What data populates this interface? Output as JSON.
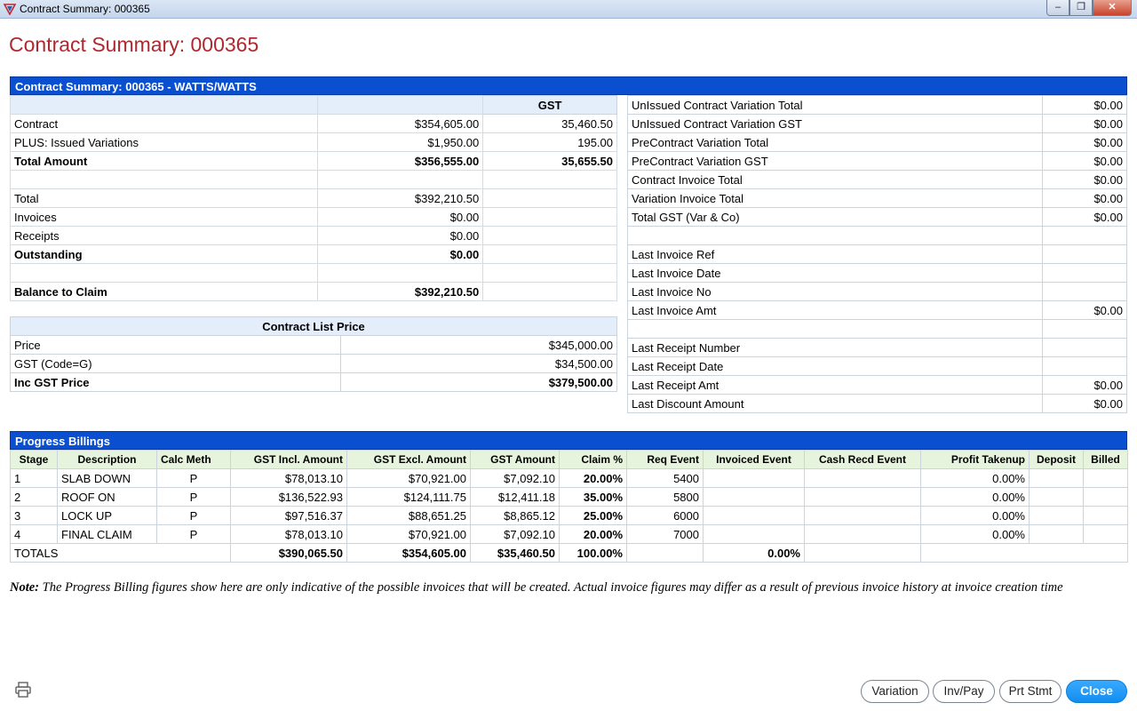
{
  "window": {
    "title": "Contract Summary: 000365"
  },
  "page_title": "Contract Summary: 000365",
  "summary": {
    "header": "Contract Summary: 000365 - WATTS/WATTS",
    "gst_header": "GST",
    "rows": [
      {
        "label": "",
        "amount": "",
        "gst": "",
        "bold": false
      },
      {
        "label": "Contract",
        "amount": "$354,605.00",
        "gst": "35,460.50",
        "bold": false
      },
      {
        "label": "PLUS: Issued Variations",
        "amount": "$1,950.00",
        "gst": "195.00",
        "bold": false
      },
      {
        "label": "Total Amount",
        "amount": "$356,555.00",
        "gst": "35,655.50",
        "bold": true
      },
      {
        "label": "",
        "amount": "",
        "gst": "",
        "bold": false
      },
      {
        "label": "Total",
        "amount": "$392,210.50",
        "gst": "",
        "bold": false
      },
      {
        "label": "Invoices",
        "amount": "$0.00",
        "gst": "",
        "bold": false
      },
      {
        "label": "Receipts",
        "amount": "$0.00",
        "gst": "",
        "bold": false
      },
      {
        "label": "Outstanding",
        "amount": "$0.00",
        "gst": "",
        "bold": true
      },
      {
        "label": "",
        "amount": "",
        "gst": "",
        "bold": false
      },
      {
        "label": "Balance to Claim",
        "amount": "$392,210.50",
        "gst": "",
        "bold": true
      }
    ],
    "right_rows": [
      {
        "label": "UnIssued Contract Variation Total",
        "value": "$0.00"
      },
      {
        "label": "UnIssued Contract Variation GST",
        "value": "$0.00"
      },
      {
        "label": "PreContract Variation Total",
        "value": "$0.00"
      },
      {
        "label": "PreContract Variation GST",
        "value": "$0.00"
      },
      {
        "label": "Contract Invoice Total",
        "value": "$0.00"
      },
      {
        "label": "Variation Invoice Total",
        "value": "$0.00"
      },
      {
        "label": "Total GST (Var & Co)",
        "value": "$0.00"
      },
      {
        "label": "",
        "value": ""
      },
      {
        "label": "Last Invoice Ref",
        "value": ""
      },
      {
        "label": "Last Invoice Date",
        "value": ""
      },
      {
        "label": "Last Invoice No",
        "value": ""
      },
      {
        "label": "Last Invoice Amt",
        "value": "$0.00"
      },
      {
        "label": "",
        "value": ""
      },
      {
        "label": "Last Receipt Number",
        "value": ""
      },
      {
        "label": "Last Receipt Date",
        "value": ""
      },
      {
        "label": "Last Receipt Amt",
        "value": "$0.00"
      },
      {
        "label": "Last Discount Amount",
        "value": "$0.00"
      }
    ]
  },
  "list_price": {
    "header": "Contract List Price",
    "rows": [
      {
        "label": "Price",
        "value": "$345,000.00",
        "bold": false
      },
      {
        "label": "GST (Code=G)",
        "value": "$34,500.00",
        "bold": false
      },
      {
        "label": "Inc GST Price",
        "value": "$379,500.00",
        "bold": true
      }
    ]
  },
  "progress": {
    "header": "Progress Billings",
    "columns": [
      "Stage",
      "Description",
      "Calc Meth",
      "GST Incl. Amount",
      "GST Excl. Amount",
      "GST Amount",
      "Claim %",
      "Req Event",
      "Invoiced Event",
      "Cash Recd Event",
      "Profit Takenup",
      "Deposit",
      "Billed"
    ],
    "rows": [
      [
        "1",
        "SLAB DOWN",
        "P",
        "$78,013.10",
        "$70,921.00",
        "$7,092.10",
        "20.00%",
        "5400",
        "",
        "",
        "0.00%",
        "",
        ""
      ],
      [
        "2",
        "ROOF ON",
        "P",
        "$136,522.93",
        "$124,111.75",
        "$12,411.18",
        "35.00%",
        "5800",
        "",
        "",
        "0.00%",
        "",
        ""
      ],
      [
        "3",
        "LOCK UP",
        "P",
        "$97,516.37",
        "$88,651.25",
        "$8,865.12",
        "25.00%",
        "6000",
        "",
        "",
        "0.00%",
        "",
        ""
      ],
      [
        "4",
        "FINAL CLAIM",
        "P",
        "$78,013.10",
        "$70,921.00",
        "$7,092.10",
        "20.00%",
        "7000",
        "",
        "",
        "0.00%",
        "",
        ""
      ]
    ],
    "totals": {
      "label": "TOTALS",
      "gst_incl": "$390,065.50",
      "gst_excl": "$354,605.00",
      "gst": "$35,460.50",
      "claim": "100.00%",
      "invoiced": "0.00%"
    }
  },
  "note": {
    "label": "Note:",
    "text": " The Progress Billing figures show here are only indicative of the possible invoices that will be created. Actual invoice figures may differ as a result of previous invoice history at invoice creation time"
  },
  "buttons": {
    "variation": "Variation",
    "inv_pay": "Inv/Pay",
    "prt_stmt": "Prt Stmt",
    "close": "Close"
  },
  "colors": {
    "accent": "#0a4fcf",
    "title": "#b0282f",
    "primary_button": "#1a93f5"
  }
}
